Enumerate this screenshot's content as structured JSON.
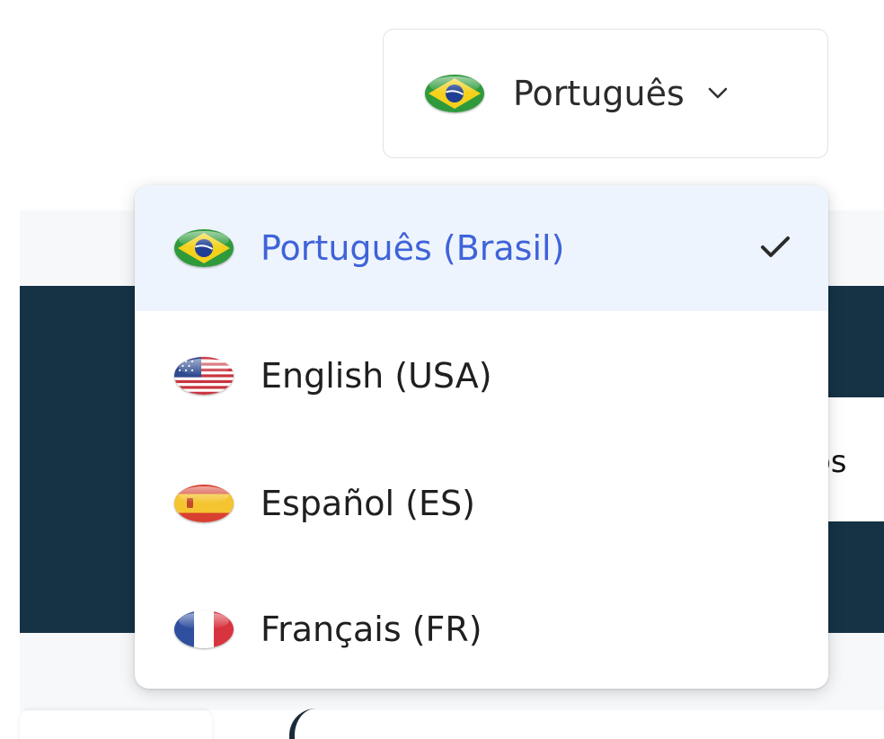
{
  "language_selector": {
    "current_label": "Português",
    "current_flag_icon": "brazil-flag-icon",
    "chevron_icon": "chevron-down-icon"
  },
  "language_menu": {
    "items": [
      {
        "label": "Português (Brasil)",
        "flag_icon": "brazil-flag-icon",
        "selected": true
      },
      {
        "label": "English (USA)",
        "flag_icon": "usa-flag-icon",
        "selected": false
      },
      {
        "label": "Español (ES)",
        "flag_icon": "spain-flag-icon",
        "selected": false
      },
      {
        "label": "Français (FR)",
        "flag_icon": "france-flag-icon",
        "selected": false
      }
    ],
    "selected_check_icon": "checkmark-icon"
  },
  "background": {
    "partial_text": "os"
  },
  "colors": {
    "selected_text": "#3f63d8",
    "selected_background": "#eef4fd",
    "dark_band": "#163245",
    "text": "#1f1f1f"
  }
}
